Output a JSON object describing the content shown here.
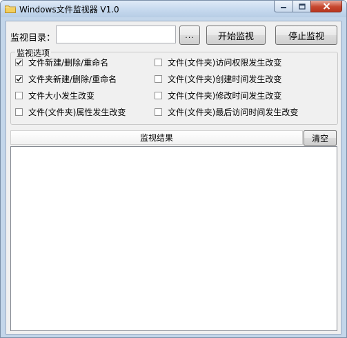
{
  "window": {
    "title": "Windows文件监视器 V1.0"
  },
  "toolbar": {
    "dir_label": "监视目录：",
    "dir_value": "",
    "browse_label": "...",
    "start_label": "开始监视",
    "stop_label": "停止监视"
  },
  "options": {
    "title": "监视选项",
    "items": [
      {
        "label": "文件新建/删除/重命名",
        "checked": true
      },
      {
        "label": "文件夹新建/删除/重命名",
        "checked": true
      },
      {
        "label": "文件大小发生改变",
        "checked": false
      },
      {
        "label": "文件(文件夹)属性发生改变",
        "checked": false
      },
      {
        "label": "文件(文件夹)访问权限发生改变",
        "checked": false
      },
      {
        "label": "文件(文件夹)创建时间发生改变",
        "checked": false
      },
      {
        "label": "文件(文件夹)修改时间发生改变",
        "checked": false
      },
      {
        "label": "文件(文件夹)最后访问时间发生改变",
        "checked": false
      }
    ]
  },
  "results": {
    "header": "监视结果",
    "clear_label": "清空",
    "entries": []
  }
}
